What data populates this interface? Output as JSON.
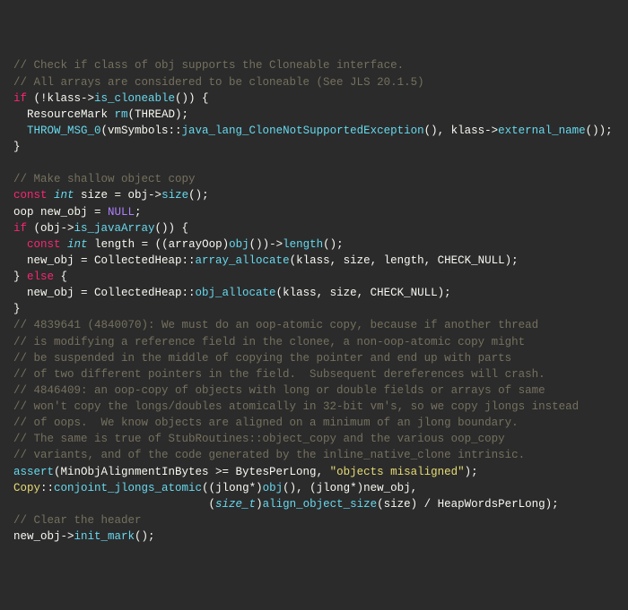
{
  "lines": {
    "c1": "// Check if class of obj supports the Cloneable interface.",
    "c2": "// All arrays are considered to be cloneable (See JLS 20.1.5)",
    "l3_if": "if",
    "l3_a": " (!klass->",
    "l3_fn": "is_cloneable",
    "l3_b": "()) {",
    "l4_a": "  ResourceMark ",
    "l4_fn": "rm",
    "l4_b": "(THREAD);",
    "l5_fn": "THROW_MSG_0",
    "l5_a": "(vmSymbols::",
    "l5_fn2": "java_lang_CloneNotSupportedException",
    "l5_b": "(), klass->",
    "l5_fn3": "external_name",
    "l5_c": "());",
    "l6": "}",
    "c3": "// Make shallow object copy",
    "l8_kw": "const",
    "l8_ty": "int",
    "l8_a": " size = obj->",
    "l8_fn": "size",
    "l8_b": "();",
    "l9_a": "oop new_obj = ",
    "l9_nul": "NULL",
    "l9_b": ";",
    "l10_if": "if",
    "l10_a": " (obj->",
    "l10_fn": "is_javaArray",
    "l10_b": "()) {",
    "l11_kw": "const",
    "l11_ty": "int",
    "l11_a": " length = ((arrayOop)",
    "l11_fn": "obj",
    "l11_b": "())->",
    "l11_fn2": "length",
    "l11_c": "();",
    "l12_a": "  new_obj = CollectedHeap::",
    "l12_fn": "array_allocate",
    "l12_b": "(klass, size, length, CHECK_NULL);",
    "l13_a": "} ",
    "l13_kw": "else",
    "l13_b": " {",
    "l14_a": "  new_obj = CollectedHeap::",
    "l14_fn": "obj_allocate",
    "l14_b": "(klass, size, CHECK_NULL);",
    "l15": "}",
    "c4": "// 4839641 (4840070): We must do an oop-atomic copy, because if another thread",
    "c5": "// is modifying a reference field in the clonee, a non-oop-atomic copy might",
    "c6": "// be suspended in the middle of copying the pointer and end up with parts",
    "c7": "// of two different pointers in the field.  Subsequent dereferences will crash.",
    "c8": "// 4846409: an oop-copy of objects with long or double fields or arrays of same",
    "c9": "// won't copy the longs/doubles atomically in 32-bit vm's, so we copy jlongs instead",
    "c10": "// of oops.  We know objects are aligned on a minimum of an jlong boundary.",
    "c11": "// The same is true of StubRoutines::object_copy and the various oop_copy",
    "c12": "// variants, and of the code generated by the inline_native_clone intrinsic.",
    "l25_fn": "assert",
    "l25_a": "(MinObjAlignmentInBytes >= BytesPerLong, ",
    "l25_str": "\"objects misaligned\"",
    "l25_b": ");",
    "l26_cls": "Copy",
    "l26_a": "::",
    "l26_fn": "conjoint_jlongs_atomic",
    "l26_b": "((jlong*)",
    "l26_fn2": "obj",
    "l26_c": "(), (jlong*)new_obj,",
    "l27_a": "                             (",
    "l27_ty": "size_t",
    "l27_b": ")",
    "l27_fn": "align_object_size",
    "l27_c": "(size) / HeapWordsPerLong);",
    "c13": "// Clear the header",
    "l29_a": "new_obj->",
    "l29_fn": "init_mark",
    "l29_b": "();"
  }
}
